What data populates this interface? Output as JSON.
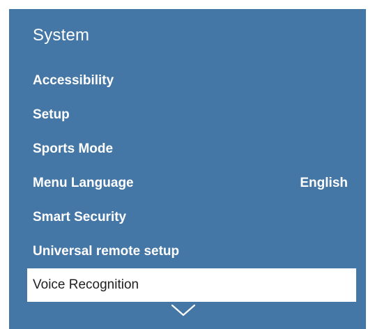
{
  "menu": {
    "title": "System",
    "items": [
      {
        "label": "Accessibility",
        "value": ""
      },
      {
        "label": "Setup",
        "value": ""
      },
      {
        "label": "Sports Mode",
        "value": ""
      },
      {
        "label": "Menu Language",
        "value": "English"
      },
      {
        "label": "Smart Security",
        "value": ""
      },
      {
        "label": "Universal remote setup",
        "value": ""
      },
      {
        "label": "Voice Recognition",
        "value": ""
      }
    ],
    "selected_index": 6,
    "scroll_indicator_icon": "chevron-down-icon"
  },
  "colors": {
    "panel_background": "#4577a6",
    "text": "#ffffff",
    "selected_background": "#ffffff",
    "selected_text": "#1f1f1f"
  }
}
